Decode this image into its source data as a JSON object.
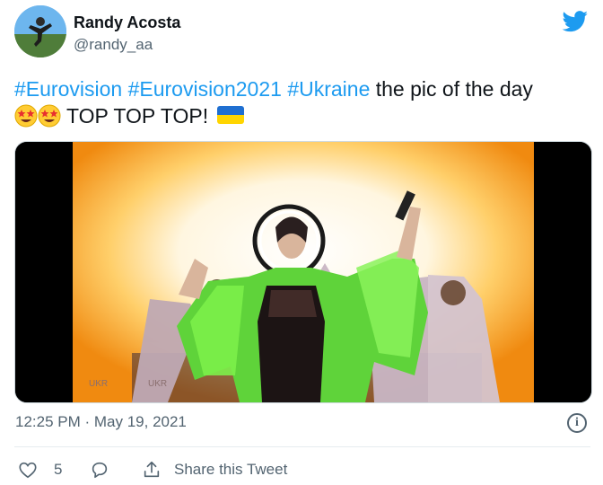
{
  "author": {
    "name": "Randy Acosta",
    "handle": "@randy_aa"
  },
  "tweet": {
    "hashtags": [
      "#Eurovision",
      "#Eurovision2021",
      "#Ukraine"
    ],
    "text_line1": "the pic of the day",
    "text_line2": "TOP TOP TOP!",
    "emoji": [
      "star-struck",
      "star-struck"
    ],
    "flag": "ukraine-flag"
  },
  "media": {
    "watermark": "UKR"
  },
  "timestamp": "12:25 PM · May 19, 2021",
  "actions": {
    "like_count": "5",
    "share_label": "Share this Tweet"
  },
  "colors": {
    "link": "#1d9bf0",
    "muted": "#536471",
    "flag_blue": "#1f6fd1",
    "flag_yellow": "#ffd500"
  }
}
